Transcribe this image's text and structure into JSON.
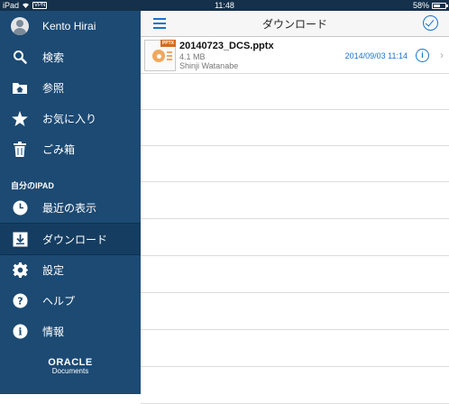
{
  "status_bar": {
    "device": "iPad",
    "vpn": "VPN",
    "time": "11:48",
    "battery": "58%",
    "battery_level": 0.58
  },
  "sidebar": {
    "user": {
      "name": "Kento Hirai",
      "icon": "avatar-icon"
    },
    "items": [
      {
        "label": "検索",
        "icon": "search-icon"
      },
      {
        "label": "参照",
        "icon": "folder-home-icon"
      },
      {
        "label": "お気に入り",
        "icon": "star-icon"
      },
      {
        "label": "ごみ箱",
        "icon": "trash-icon"
      }
    ],
    "section_header": "自分のIPAD",
    "ipad_items": [
      {
        "label": "最近の表示",
        "icon": "clock-icon"
      },
      {
        "label": "ダウンロード",
        "icon": "download-icon",
        "active": true
      },
      {
        "label": "設定",
        "icon": "gear-icon"
      },
      {
        "label": "ヘルプ",
        "icon": "help-icon"
      },
      {
        "label": "情報",
        "icon": "info-icon"
      }
    ],
    "brand": "ORACLE",
    "brand_sub": "Documents"
  },
  "main": {
    "title": "ダウンロード",
    "files": [
      {
        "name": "20140723_DCS.pptx",
        "type_tag": "PPTX",
        "size": "4.1 MB",
        "owner": "Shinji Watanabe",
        "date": "2014/09/03 11:14"
      }
    ]
  },
  "colors": {
    "sidebar_bg": "#1c4a73",
    "accent": "#1a73c8",
    "pptx_orange": "#d46c1e"
  }
}
